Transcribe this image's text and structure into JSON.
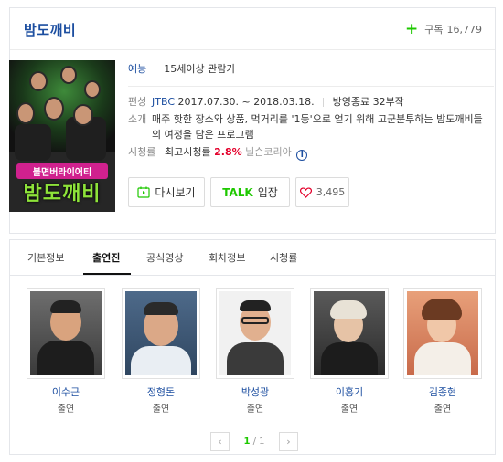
{
  "program": {
    "title": "밤도깨비",
    "subscribe_label": "구독",
    "subscribe_count": "16,779",
    "poster_subtitle": "불면버라이어티",
    "poster_logo": "밤도깨비"
  },
  "info": {
    "genre": "예능",
    "age_rating": "15세이상 관람가",
    "schedule_key": "편성",
    "channel": "JTBC",
    "dates": "2017.07.30. ~ 2018.03.18.",
    "status": "방영종료 32부작",
    "desc_key": "소개",
    "description": "매주 핫한 장소와 상품, 먹거리를 '1등'으로 얻기 위해 고군분투하는 밤도깨비들의 여정을 담은 프로그램",
    "rating_key": "시청률",
    "rating_label": "최고시청률",
    "rating_value": "2.8%",
    "rating_source": "닐슨코리아"
  },
  "buttons": {
    "replay": "다시보기",
    "talk_word": "TALK",
    "talk_suffix": "입장",
    "like_count": "3,495"
  },
  "tabs": [
    {
      "label": "기본정보"
    },
    {
      "label": "출연진"
    },
    {
      "label": "공식영상"
    },
    {
      "label": "회차정보"
    },
    {
      "label": "시청률"
    }
  ],
  "cast": [
    {
      "name": "이수근",
      "role": "출연"
    },
    {
      "name": "정형돈",
      "role": "출연"
    },
    {
      "name": "박성광",
      "role": "출연"
    },
    {
      "name": "이홍기",
      "role": "출연"
    },
    {
      "name": "김종현",
      "role": "출연"
    }
  ],
  "pagination": {
    "current": "1",
    "separator": "/",
    "total": "1"
  },
  "colors": {
    "title": "#1c4ea0",
    "accent_green": "#1ec800",
    "rating_red": "#e4002b"
  },
  "icons": [
    "plus-icon",
    "replay-icon",
    "heart-icon",
    "info-icon",
    "chevron-left-icon",
    "chevron-right-icon"
  ]
}
